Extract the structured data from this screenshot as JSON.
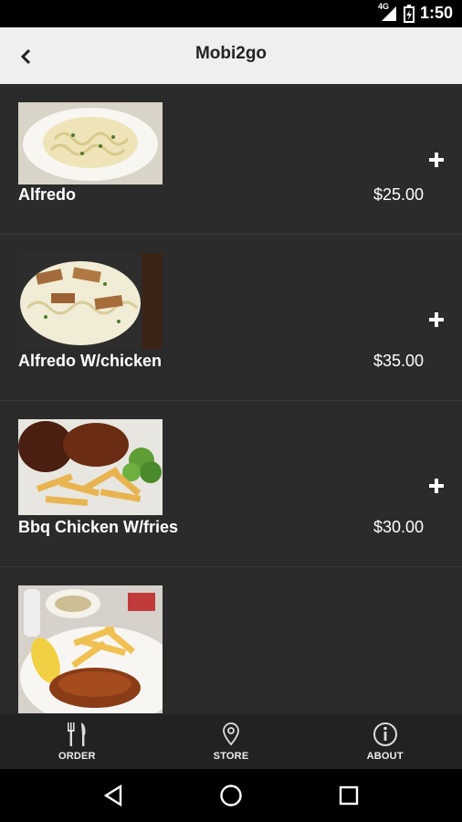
{
  "status_bar": {
    "network": "4G",
    "time": "1:50"
  },
  "app_bar": {
    "title": "Mobi2go"
  },
  "menu_items": [
    {
      "name": "Alfredo",
      "price": "$25.00"
    },
    {
      "name": "Alfredo W/chicken",
      "price": "$35.00"
    },
    {
      "name": "Bbq Chicken W/fries",
      "price": "$30.00"
    },
    {
      "name": "",
      "price": ""
    }
  ],
  "bottom_nav": {
    "order": "ORDER",
    "store": "STORE",
    "about": "ABOUT"
  },
  "colors": {
    "background": "#2b2b2b",
    "app_bar": "#efefef",
    "bottom_nav": "#222222"
  }
}
